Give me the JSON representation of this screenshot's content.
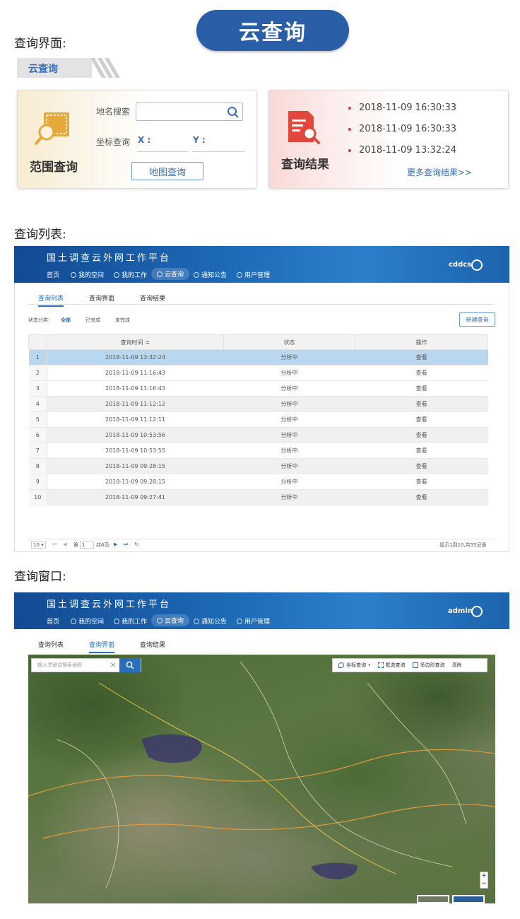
{
  "banner_title": "云查询",
  "sections": {
    "query_ui": "查询界面:",
    "query_list": "查询列表:",
    "query_window": "查询窗口:"
  },
  "ribbon_tab": "云查询",
  "range_card": {
    "title": "范围查询",
    "place_search_label": "地名搜索",
    "coord_label": "坐标查询",
    "x_label": "X :",
    "y_label": "Y :",
    "map_query_button": "地图查询"
  },
  "result_card": {
    "title": "查询结果",
    "items": [
      "2018-11-09 16:30:33",
      "2018-11-09 16:30:33",
      "2018-11-09 13:32:24"
    ],
    "more_link": "更多查询结果>>"
  },
  "app_list": {
    "title": "国土调查云外网工作平台",
    "nav": [
      "首页",
      "我的空间",
      "我的工作",
      "云查询",
      "通知公告",
      "用户管理"
    ],
    "active_nav": "云查询",
    "user": "cddcs",
    "tabs": [
      "查询列表",
      "查询界面",
      "查询结果"
    ],
    "filter_label": "状态分类：",
    "filters": [
      "全部",
      "已完成",
      "未完成"
    ],
    "new_button": "新建查询",
    "columns": [
      "查询时间 ≑",
      "状态",
      "操作"
    ],
    "rows": [
      {
        "n": "1",
        "time": "2018-11-09 13:32:24",
        "status": "分析中",
        "action": "查看"
      },
      {
        "n": "2",
        "time": "2018-11-09 11:16:43",
        "status": "分析中",
        "action": "查看"
      },
      {
        "n": "3",
        "time": "2018-11-09 11:16:43",
        "status": "分析中",
        "action": "查看"
      },
      {
        "n": "4",
        "time": "2018-11-09 11:12:12",
        "status": "分析中",
        "action": "查看"
      },
      {
        "n": "5",
        "time": "2018-11-09 11:12:11",
        "status": "分析中",
        "action": "查看"
      },
      {
        "n": "6",
        "time": "2018-11-09 10:53:56",
        "status": "分析中",
        "action": "查看"
      },
      {
        "n": "7",
        "time": "2018-11-09 10:53:55",
        "status": "分析中",
        "action": "查看"
      },
      {
        "n": "8",
        "time": "2018-11-09 09:28:15",
        "status": "分析中",
        "action": "查看"
      },
      {
        "n": "9",
        "time": "2018-11-09 09:28:15",
        "status": "分析中",
        "action": "查看"
      },
      {
        "n": "10",
        "time": "2018-11-09 09:27:41",
        "status": "分析中",
        "action": "查看"
      }
    ],
    "pager": {
      "page_size": "10 ▾",
      "page_label": "第",
      "page_value": "1",
      "total_pages": "共6页",
      "summary": "显示1到10,共55记录"
    }
  },
  "app_map": {
    "title": "国土调查云外网工作平台",
    "nav": [
      "首页",
      "我的空间",
      "我的工作",
      "云查询",
      "通知公告",
      "用户管理"
    ],
    "user": "admin",
    "tabs": [
      "查询列表",
      "查询界面",
      "查询结果"
    ],
    "search_placeholder": "输入关键词搜索地图",
    "tools": [
      "坐标查询",
      "框选查询",
      "多边形查询",
      "清除"
    ],
    "zoom_in": "+",
    "zoom_out": "−"
  },
  "colors": {
    "accent": "#2a5fa8",
    "header_blue": "#1e6bb8",
    "selected_row": "#b9d8f0",
    "bullet_red": "#d03a3a"
  }
}
